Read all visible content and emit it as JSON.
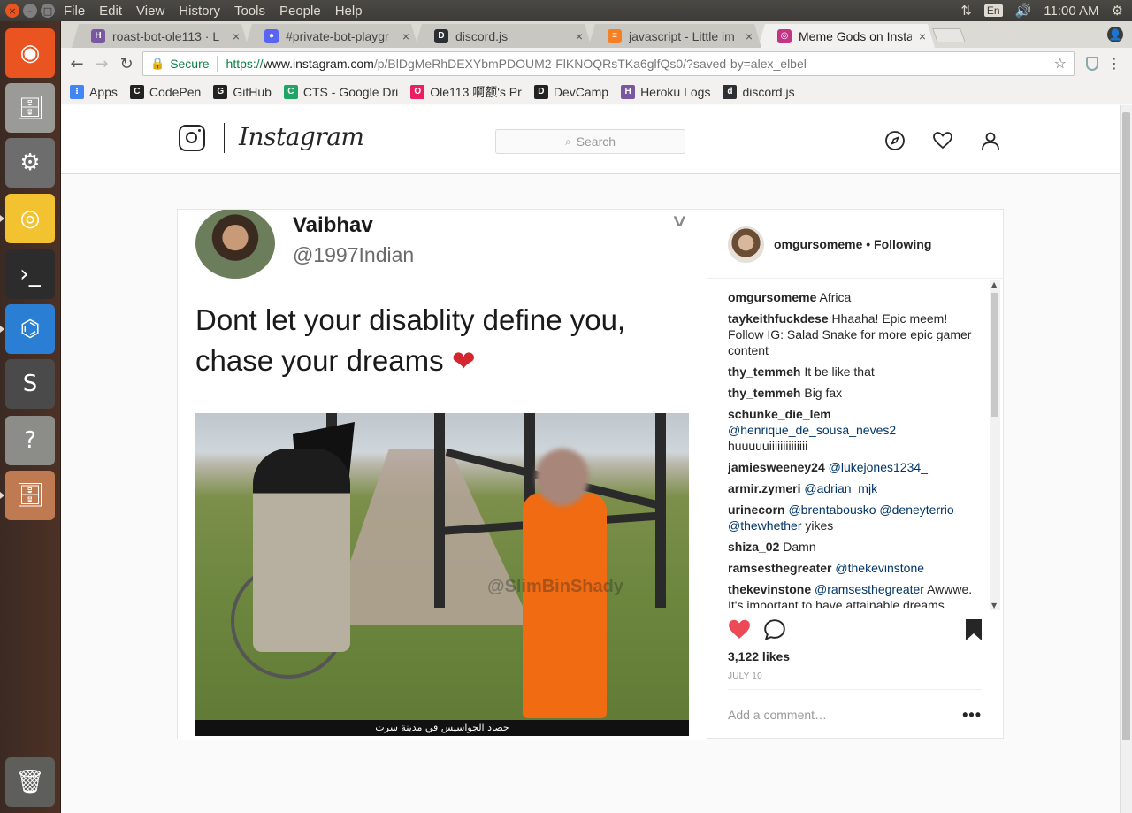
{
  "os": {
    "menus": [
      "File",
      "Edit",
      "View",
      "History",
      "Tools",
      "People",
      "Help"
    ],
    "tray": {
      "lang": "En",
      "time": "11:00 AM"
    },
    "launcher": [
      {
        "name": "ubuntu-dash-icon",
        "color": "#e95420",
        "glyph": "◉"
      },
      {
        "name": "files-icon",
        "color": "#9a9a96",
        "glyph": "🗄"
      },
      {
        "name": "system-settings-icon",
        "color": "#6d6d6d",
        "glyph": "⚙"
      },
      {
        "name": "chrome-icon",
        "color": "#f2c230",
        "glyph": "◎"
      },
      {
        "name": "terminal-icon",
        "color": "#2c2c2c",
        "glyph": "›_"
      },
      {
        "name": "vscode-icon",
        "color": "#2a7fd4",
        "glyph": "⌬"
      },
      {
        "name": "sublime-text-icon",
        "color": "#4a4a4a",
        "glyph": "S"
      },
      {
        "name": "unknown-app-icon",
        "color": "#8c8c88",
        "glyph": "?"
      },
      {
        "name": "files-icon-2",
        "color": "#c07a52",
        "glyph": "🗄"
      }
    ],
    "trash": {
      "name": "trash-icon",
      "glyph": "🗑"
    }
  },
  "browser": {
    "tabs": [
      {
        "label": "roast-bot-ole113 · L",
        "fav": "H",
        "fav_color": "#79589f",
        "active": false
      },
      {
        "label": "#private-bot-playgr",
        "fav": "●",
        "fav_color": "#5865f2",
        "active": false
      },
      {
        "label": "discord.js",
        "fav": "D",
        "fav_color": "#2c2f33",
        "active": false
      },
      {
        "label": "javascript - Little im",
        "fav": "≡",
        "fav_color": "#f48024",
        "active": false
      },
      {
        "label": "Meme Gods on Insta",
        "fav": "◎",
        "fav_color": "#c13584",
        "active": true
      }
    ],
    "url": {
      "secure_label": "Secure",
      "scheme": "https://",
      "host": "www.instagram.com",
      "path": "/p/BlDgMeRhDEXYbmPDOUM2-FlKNOQRsTKa6glfQs0/?saved-by=alex_elbel"
    },
    "bookmarks": [
      {
        "label": "Apps",
        "icon": "apps-grid-icon",
        "color": "#4285f4"
      },
      {
        "label": "CodePen",
        "icon": "codepen-icon",
        "color": "#222"
      },
      {
        "label": "GitHub",
        "icon": "github-icon",
        "color": "#222"
      },
      {
        "label": "CTS - Google Dri",
        "icon": "google-drive-icon",
        "color": "#1fa463"
      },
      {
        "label": "Ole113 啊额's Pr",
        "icon": "pinwheel-icon",
        "color": "#e91e63"
      },
      {
        "label": "DevCamp",
        "icon": "devcamp-icon",
        "color": "#222"
      },
      {
        "label": "Heroku Logs",
        "icon": "heroku-icon",
        "color": "#79589f"
      },
      {
        "label": "discord.js",
        "icon": "discordjs-icon",
        "color": "#2c2f33"
      }
    ]
  },
  "instagram": {
    "search_placeholder": "Search",
    "wordmark": "Instagram",
    "post": {
      "meme": {
        "name": "Vaibhav",
        "handle": "@1997Indian",
        "text": "Dont let your disablity define you, chase your dreams",
        "watermark": "@SlimBinShady",
        "caption": "حصاد الجواسيس في مدينة سرت"
      },
      "author": "omgursomeme",
      "follow_label": "Following",
      "comments": [
        {
          "user": "omgursomeme",
          "parts": [
            {
              "t": "Africa"
            }
          ]
        },
        {
          "user": "taykeithfuckdese",
          "parts": [
            {
              "t": "Hhaaha! Epic meem! Follow IG: Salad Snake for more epic gamer content"
            }
          ]
        },
        {
          "user": "thy_temmeh",
          "parts": [
            {
              "t": "It be like that"
            }
          ]
        },
        {
          "user": "thy_temmeh",
          "parts": [
            {
              "t": "Big fax"
            }
          ]
        },
        {
          "user": "schunke_die_lem",
          "parts": [
            {
              "t": "@henrique_de_sousa_neves2",
              "m": true
            },
            {
              "t": " huuuuuiiiiiiiiiiiiii"
            }
          ]
        },
        {
          "user": "jamiesweeney24",
          "parts": [
            {
              "t": "@lukejones1234_",
              "m": true
            }
          ]
        },
        {
          "user": "armir.zymeri",
          "parts": [
            {
              "t": "@adrian_mjk",
              "m": true
            }
          ]
        },
        {
          "user": "urinecorn",
          "parts": [
            {
              "t": "@brentabousko @deneyterrio @thewhether",
              "m": true
            },
            {
              "t": " yikes"
            }
          ]
        },
        {
          "user": "shiza_02",
          "parts": [
            {
              "t": "Damn"
            }
          ]
        },
        {
          "user": "ramsesthegreater",
          "parts": [
            {
              "t": "@thekevinstone",
              "m": true
            }
          ]
        },
        {
          "user": "thekevinstone",
          "parts": [
            {
              "t": "@ramsesthegreater",
              "m": true
            },
            {
              "t": " Awwwe. It's important to have attainable dreams"
            }
          ]
        }
      ],
      "likes": "3,122 likes",
      "date": "JULY 10",
      "add_comment_placeholder": "Add a comment…",
      "liked": true,
      "colors": {
        "like": "#ed4956",
        "mention": "#003569"
      }
    }
  }
}
